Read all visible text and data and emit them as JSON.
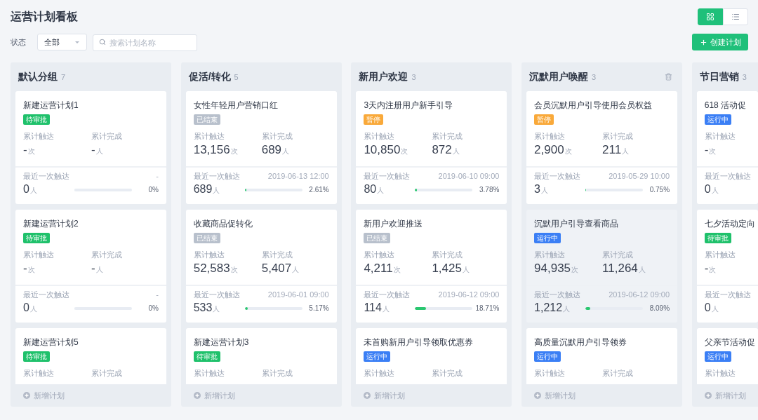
{
  "page": {
    "title": "运营计划看板"
  },
  "view_toggle": [
    {
      "kind": "grid",
      "selected": true
    },
    {
      "kind": "list",
      "selected": false
    }
  ],
  "filters": {
    "status_label": "状态",
    "status_value": "全部",
    "search": {
      "placeholder": "搜索计划名称"
    }
  },
  "create_button": "创建计划",
  "columns": [
    {
      "title": "默认分组",
      "count": "7",
      "show_delete": false,
      "footer": "新增计划",
      "cards": [
        {
          "title": "新建运营计划1",
          "highlighted": false,
          "status": {
            "label": "待审批",
            "color": "#1fc16b"
          },
          "stats": [
            {
              "label": "累计触达",
              "value": "-",
              "unit": "次"
            },
            {
              "label": "累计完成",
              "value": "-",
              "unit": "人"
            }
          ],
          "last": {
            "label": "最近一次触达",
            "date": "-",
            "value": "0",
            "unit": "人",
            "level": 0,
            "percent": "0%"
          }
        },
        {
          "title": "新建运营计划2",
          "highlighted": false,
          "status": {
            "label": "待审批",
            "color": "#1fc16b"
          },
          "stats": [
            {
              "label": "累计触达",
              "value": "-",
              "unit": "次"
            },
            {
              "label": "累计完成",
              "value": "-",
              "unit": "人"
            }
          ],
          "last": {
            "label": "最近一次触达",
            "date": "-",
            "value": "0",
            "unit": "人",
            "level": 0,
            "percent": "0%"
          }
        },
        {
          "title": "新建运营计划5",
          "highlighted": false,
          "status": {
            "label": "待审批",
            "color": "#1fc16b"
          },
          "stats": [
            {
              "label": "累计触达"
            },
            {
              "label": "累计完成"
            }
          ]
        }
      ]
    },
    {
      "title": "促活/转化",
      "count": "5",
      "show_delete": false,
      "footer": "新增计划",
      "cards": [
        {
          "title": "女性年轻用户营销口红",
          "highlighted": false,
          "status": {
            "label": "已结束",
            "color": "#b8c0cc"
          },
          "stats": [
            {
              "label": "累计触达",
              "value": "13,156",
              "unit": "次"
            },
            {
              "label": "累计完成",
              "value": "689",
              "unit": "人"
            }
          ],
          "last": {
            "label": "最近一次触达",
            "date": "2019-06-13 12:00",
            "value": "689",
            "unit": "人",
            "level": 0.0261,
            "percent": "2.61%"
          }
        },
        {
          "title": "收藏商品促转化",
          "highlighted": false,
          "status": {
            "label": "已结束",
            "color": "#b8c0cc"
          },
          "stats": [
            {
              "label": "累计触达",
              "value": "52,583",
              "unit": "次"
            },
            {
              "label": "累计完成",
              "value": "5,407",
              "unit": "人"
            }
          ],
          "last": {
            "label": "最近一次触达",
            "date": "2019-06-01 09:00",
            "value": "533",
            "unit": "人",
            "level": 0.0517,
            "percent": "5.17%"
          }
        },
        {
          "title": "新建运营计划3",
          "highlighted": false,
          "status": {
            "label": "待审批",
            "color": "#1fc16b"
          },
          "stats": [
            {
              "label": "累计触达"
            },
            {
              "label": "累计完成"
            }
          ]
        }
      ]
    },
    {
      "title": "新用户欢迎",
      "count": "3",
      "show_delete": false,
      "footer": "新增计划",
      "cards": [
        {
          "title": "3天内注册用户新手引导",
          "highlighted": false,
          "status": {
            "label": "暂停",
            "color": "#f9a93a"
          },
          "stats": [
            {
              "label": "累计触达",
              "value": "10,850",
              "unit": "次"
            },
            {
              "label": "累计完成",
              "value": "872",
              "unit": "人"
            }
          ],
          "last": {
            "label": "最近一次触达",
            "date": "2019-06-10 09:00",
            "value": "80",
            "unit": "人",
            "level": 0.0378,
            "percent": "3.78%"
          }
        },
        {
          "title": "新用户欢迎推送",
          "highlighted": false,
          "status": {
            "label": "已结束",
            "color": "#b8c0cc"
          },
          "stats": [
            {
              "label": "累计触达",
              "value": "4,211",
              "unit": "次"
            },
            {
              "label": "累计完成",
              "value": "1,425",
              "unit": "人"
            }
          ],
          "last": {
            "label": "最近一次触达",
            "date": "2019-06-12 09:00",
            "value": "114",
            "unit": "人",
            "level": 0.1871,
            "percent": "18.71%"
          }
        },
        {
          "title": "未首购新用户引导领取优惠券",
          "highlighted": false,
          "status": {
            "label": "运行中",
            "color": "#3b7ff5"
          },
          "stats": [
            {
              "label": "累计触达"
            },
            {
              "label": "累计完成"
            }
          ]
        }
      ]
    },
    {
      "title": "沉默用户唤醒",
      "count": "3",
      "show_delete": true,
      "footer": "新增计划",
      "cards": [
        {
          "title": "会员沉默用户引导使用会员权益",
          "highlighted": false,
          "status": {
            "label": "暂停",
            "color": "#f9a93a"
          },
          "stats": [
            {
              "label": "累计触达",
              "value": "2,900",
              "unit": "次"
            },
            {
              "label": "累计完成",
              "value": "211",
              "unit": "人"
            }
          ],
          "last": {
            "label": "最近一次触达",
            "date": "2019-05-29 10:00",
            "value": "3",
            "unit": "人",
            "level": 0.0075,
            "percent": "0.75%"
          }
        },
        {
          "title": "沉默用户引导查看商品",
          "highlighted": true,
          "status": {
            "label": "运行中",
            "color": "#3b7ff5"
          },
          "stats": [
            {
              "label": "累计触达",
              "value": "94,935",
              "unit": "次"
            },
            {
              "label": "累计完成",
              "value": "11,264",
              "unit": "人"
            }
          ],
          "last": {
            "label": "最近一次触达",
            "date": "2019-06-12 09:00",
            "value": "1,212",
            "unit": "人",
            "level": 0.0809,
            "percent": "8.09%"
          }
        },
        {
          "title": "高质量沉默用户引导领券",
          "highlighted": false,
          "status": {
            "label": "运行中",
            "color": "#3b7ff5"
          },
          "stats": [
            {
              "label": "累计触达"
            },
            {
              "label": "累计完成"
            }
          ]
        }
      ]
    },
    {
      "title": "节日营销",
      "count": "3",
      "show_delete": false,
      "footer": "新增计划",
      "cards": [
        {
          "title": "618 活动促",
          "highlighted": false,
          "status": {
            "label": "运行中",
            "color": "#3b7ff5"
          },
          "stats": [
            {
              "label": "累计触达",
              "value": "-",
              "unit": "次"
            }
          ],
          "last": {
            "label": "最近一次触达",
            "value": "0",
            "unit": "人"
          }
        },
        {
          "title": "七夕活动定向",
          "highlighted": false,
          "status": {
            "label": "待审批",
            "color": "#1fc16b"
          },
          "stats": [
            {
              "label": "累计触达",
              "value": "-",
              "unit": "次"
            }
          ],
          "last": {
            "label": "最近一次触达",
            "value": "0",
            "unit": "人"
          }
        },
        {
          "title": "父亲节活动促",
          "highlighted": false,
          "status": {
            "label": "运行中",
            "color": "#3b7ff5"
          },
          "stats": [
            {
              "label": "累计触达"
            }
          ]
        }
      ]
    }
  ]
}
